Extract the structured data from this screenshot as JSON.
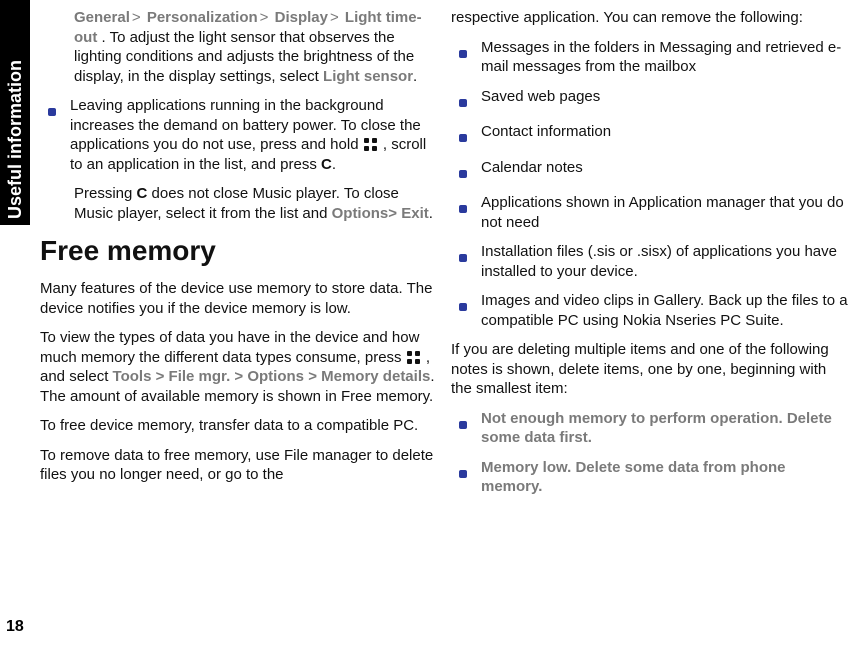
{
  "sideTab": "Useful information",
  "pageNumber": "18",
  "leftColumn": {
    "para1": {
      "breadcrumb": [
        "General",
        "Personalization",
        "Display",
        "Light time-out"
      ],
      "restA": ". To adjust the light sensor that observes the lighting conditions and adjusts the brightness of the display, in the display settings, select ",
      "lightSensor": "Light sensor",
      "restB": "."
    },
    "bullet1": {
      "a": "Leaving applications running in the background increases the demand on battery power. To close the applications you do not use, press and hold ",
      "b": ", scroll to an application in the list, and press ",
      "keyC": "C",
      "c": "."
    },
    "para2": {
      "a": "Pressing ",
      "keyC": "C",
      "b": " does not close Music player. To close Music player, select it from the list and ",
      "options": "Options",
      "sep": " > ",
      "exit": "Exit",
      "c": "."
    },
    "heading": "Free memory",
    "para3": "Many features of the device use memory to store data. The device notifies you if the device memory is low.",
    "para4": {
      "a": "To view the types of data you have in the device and how much memory the different data types consume, press ",
      "b": ", and select ",
      "tools": "Tools",
      "fileMgr": "File mgr.",
      "options": "Options",
      "memDetails": "Memory details",
      "c": ". The amount of available memory is shown in Free memory."
    },
    "para5": "To free device memory, transfer data to a compatible PC.",
    "para6": "To remove data to free memory, use File manager to delete files you no longer need, or go to the"
  },
  "rightColumn": {
    "para1": "respective application. You can remove the following:",
    "bullets": [
      "Messages in the folders in Messaging and retrieved e-mail messages from the mailbox",
      "Saved web pages",
      "Contact information",
      "Calendar notes",
      "Applications shown in Application manager that you do not need",
      "Installation files (.sis or .sisx) of applications you have installed to your device.",
      "Images and video clips in Gallery. Back up the files to a compatible PC using Nokia Nseries PC Suite."
    ],
    "para2": "If you are deleting multiple items and one of the following notes is shown, delete items, one by one, beginning with the smallest item:",
    "warnBullets": [
      "Not enough memory to perform operation. Delete some data first.",
      "Memory low. Delete some data from phone memory."
    ]
  }
}
